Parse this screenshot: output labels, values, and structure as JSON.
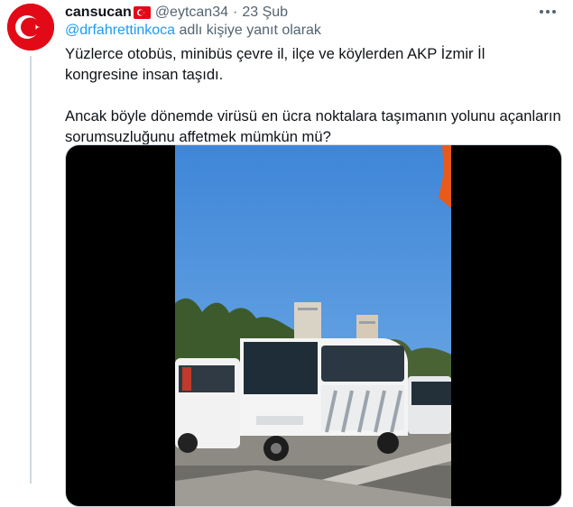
{
  "tweet": {
    "display_name": "cansucan",
    "handle": "@eytcan34",
    "separator": "·",
    "date": "23 Şub",
    "reply_to": "@drfahrettinkoca",
    "reply_suffix": " adlı kişiye yanıt olarak",
    "paragraph1": "Yüzlerce otobüs, minibüs çevre il, ilçe ve köylerden AKP İzmir İl kongresine insan taşıdı.",
    "paragraph2": "Ancak böyle dönemde virüsü en ücra noktalara taşımanın yolunu açanların sorumsuzluğunu affetmek mümkün mü?"
  },
  "icons": {
    "avatar": "turkish-flag-avatar",
    "flag": "turkish-flag-emoji",
    "more": "more-options-icon"
  },
  "colors": {
    "link": "#1d9bf0",
    "secondary_text": "#536471",
    "flag_red": "#e30a17",
    "sky": "#4f8fdc"
  }
}
